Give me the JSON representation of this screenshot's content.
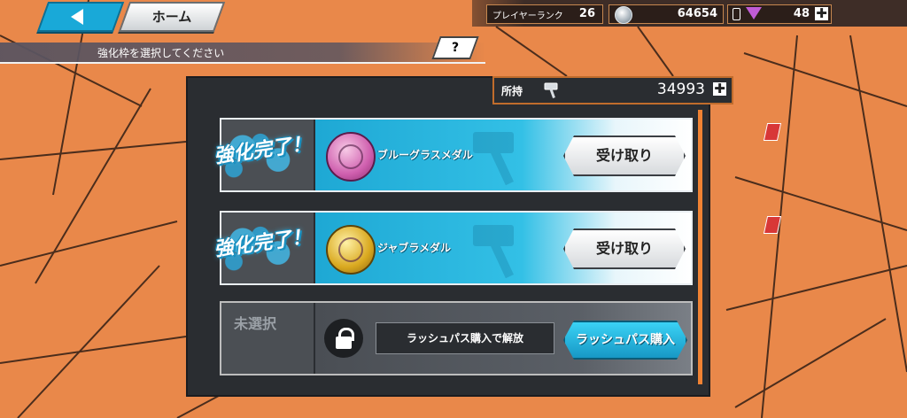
{
  "header": {
    "home_label": "ホーム",
    "player_rank_label": "プレイヤーランク",
    "player_rank_value": "26",
    "coins_value": "64654",
    "gems_value": "48",
    "plus_symbol": "✚"
  },
  "instruction": {
    "text": "強化枠を選択してください",
    "help_label": "?"
  },
  "owned": {
    "label": "所持",
    "value": "34993",
    "plus_symbol": "✚"
  },
  "slots": [
    {
      "status": "強化完了！",
      "medal_name": "ブルーグラスメダル",
      "button_label": "受け取り",
      "medal_color": "#cf5fae"
    },
    {
      "status": "強化完了！",
      "medal_name": "ジャブラメダル",
      "button_label": "受け取り",
      "medal_color": "#d9a81f"
    },
    {
      "status": "未選択",
      "unlock_text": "ラッシュパス購入で解放",
      "button_label": "ラッシュパス購入"
    }
  ],
  "colors": {
    "accent": "#1ea8d4",
    "background": "#e9884a",
    "scroll": "#f08233"
  }
}
